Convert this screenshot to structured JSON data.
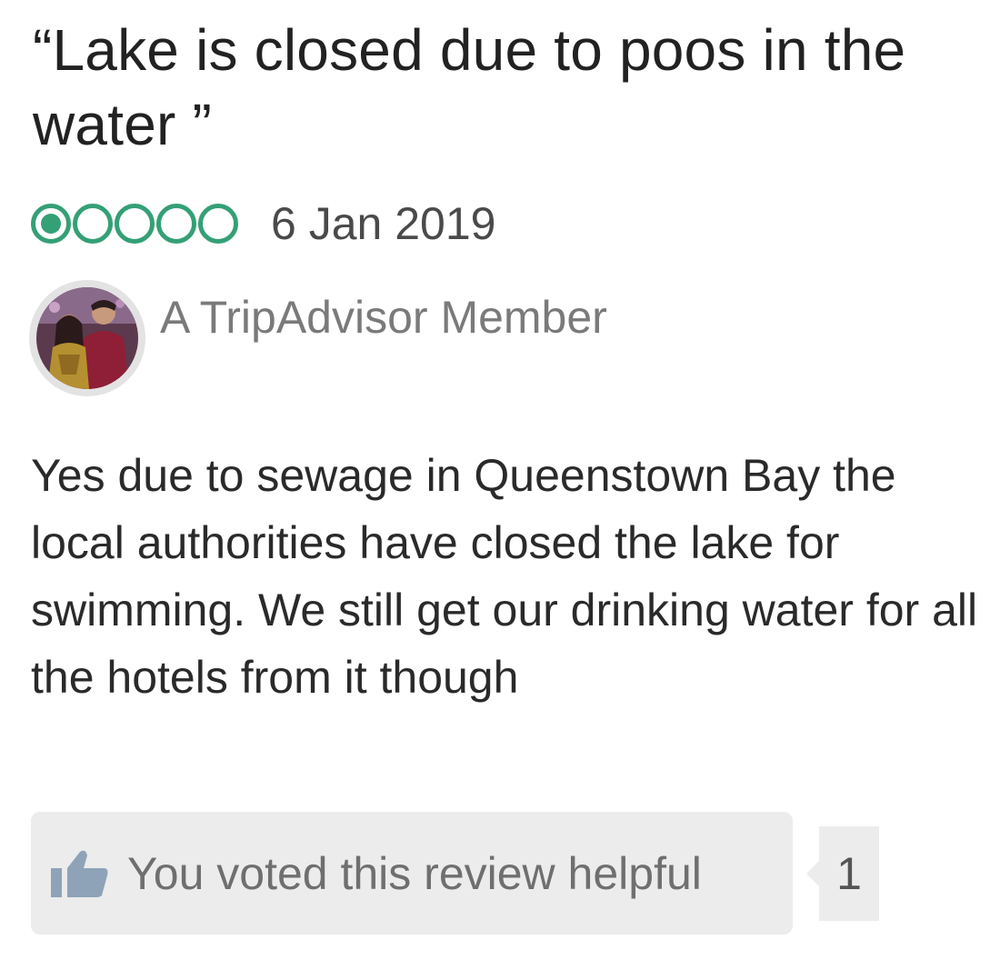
{
  "review": {
    "title": "“Lake is closed due to poos in the water ”",
    "rating": {
      "value": 1,
      "max": 5,
      "accent_color": "#34a076"
    },
    "date": "6 Jan 2019",
    "author": {
      "name": "A TripAdvisor Member",
      "avatar_icon": "user-photo-avatar"
    },
    "body": "Yes due to sewage in Queenstown Bay the local authorities have closed the lake for swimming. We still get our drinking water for all the hotels from it though",
    "helpful": {
      "label": "You voted this review helpful",
      "icon": "thumbs-up-icon",
      "count": "1"
    }
  }
}
